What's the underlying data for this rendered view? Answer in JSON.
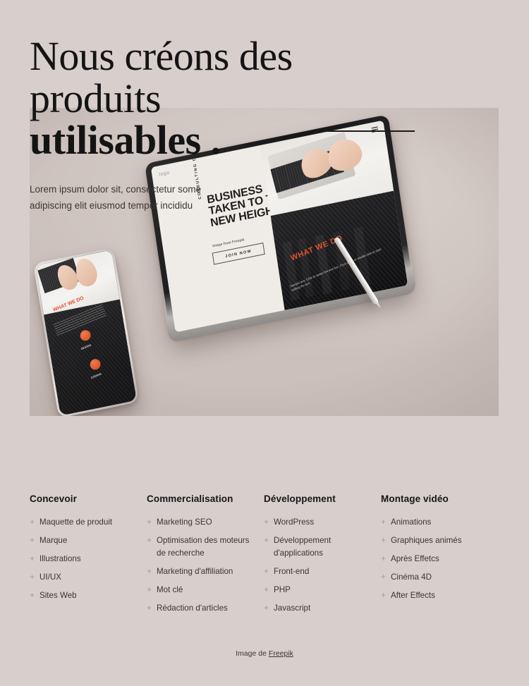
{
  "hero": {
    "headline_line1": "Nous créons des",
    "headline_line2": "produits",
    "headline_line3": "utilisables .",
    "subtitle": "Lorem ipsum dolor sit, consectetur some adipiscing elit eiusmod tempor incididu",
    "accent_rule": "decorative-rule"
  },
  "mockup": {
    "tablet": {
      "logo": "logo",
      "eyebrow": "CONSULTING COMPANY",
      "title_line1": "BUSINESS",
      "title_line2": "TAKEN TO THE",
      "title_line3": "NEW HEIGHTS",
      "caption": "Image from Freepik",
      "cta": "JOIN NOW",
      "section_label": "WHAT WE DO",
      "section_body": "Sample text. Click to select the text box. Click again or double click to start editing the text."
    },
    "phone": {
      "section_label": "WHAT WE DO",
      "feature_1": "DESIGN",
      "feature_2": "CODING"
    }
  },
  "columns": [
    {
      "title": "Concevoir",
      "items": [
        "Maquette de produit",
        "Marque",
        "Illustrations",
        "UI/UX",
        "Sites Web"
      ]
    },
    {
      "title": "Commercialisation",
      "items": [
        "Marketing SEO",
        "Optimisation des moteurs de recherche",
        "Marketing d'affiliation",
        "Mot clé",
        "Rédaction d'articles"
      ]
    },
    {
      "title": "Développement",
      "items": [
        "WordPress",
        "Développement d'applications",
        "Front-end",
        "PHP",
        "Javascript"
      ]
    },
    {
      "title": "Montage vidéo",
      "items": [
        "Animations",
        "Graphiques animés",
        "Après Effetcs",
        "Cinéma 4D",
        "After Effects"
      ]
    }
  ],
  "credit": {
    "prefix": "Image de ",
    "link": "Freepik"
  },
  "colors": {
    "page_background": "#d8cecb",
    "media_panel": "#d3cac6",
    "text": "#1b1b1b",
    "muted_text": "#3b3734",
    "plus_icon": "#a89b95",
    "accent_orange": "#e2522e"
  }
}
